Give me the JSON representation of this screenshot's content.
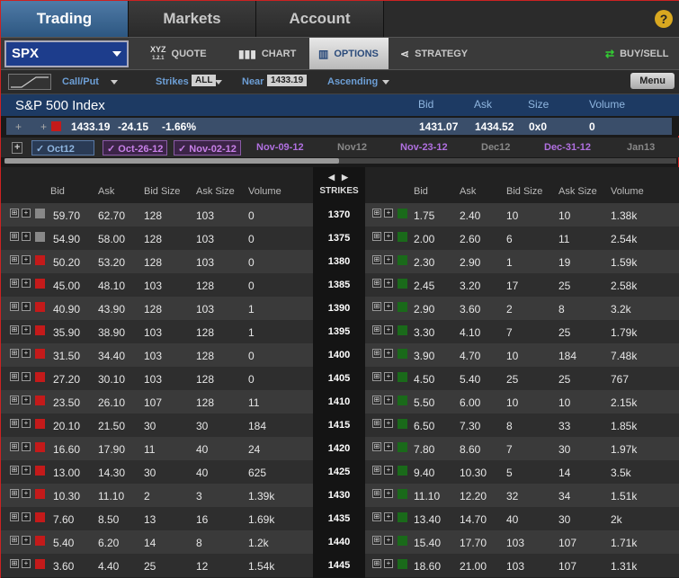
{
  "nav": {
    "tabs": [
      "Trading",
      "Markets",
      "Account"
    ],
    "help": "?"
  },
  "toolbar": {
    "symbol": "SPX",
    "quote_icon_text": "XYZ",
    "quote_icon_sub": "1.2.1",
    "quote": "QUOTE",
    "chart": "CHART",
    "options": "OPTIONS",
    "strategy": "STRATEGY",
    "buysell": "BUY/SELL"
  },
  "optbar": {
    "callput": "Call/Put",
    "strikes_label": "Strikes",
    "strikes_value": "ALL",
    "near_label": "Near",
    "near_value": "1433.19",
    "order": "Ascending",
    "menu": "Menu"
  },
  "index": {
    "name": "S&P 500 Index",
    "headers": {
      "bid": "Bid",
      "ask": "Ask",
      "size": "Size",
      "volume": "Volume"
    },
    "last": "1433.19",
    "change": "-24.15",
    "pct": "-1.66%",
    "bid": "1431.07",
    "ask": "1434.52",
    "size": "0x0",
    "volume": "0"
  },
  "expirations": [
    "Oct12",
    "Oct-26-12",
    "Nov-02-12",
    "Nov-09-12",
    "Nov12",
    "Nov-23-12",
    "Dec12",
    "Dec-31-12",
    "Jan13"
  ],
  "grid": {
    "strikes_title": "STRIKES",
    "call_headers": [
      "Bid",
      "Ask",
      "Bid Size",
      "Ask Size",
      "Volume"
    ],
    "put_headers": [
      "Bid",
      "Ask",
      "Bid Size",
      "Ask Size",
      "Volume"
    ],
    "rows": [
      {
        "strike": "1370",
        "call": [
          "59.70",
          "62.70",
          "128",
          "103",
          "0"
        ],
        "put": [
          "1.75",
          "2.40",
          "10",
          "10",
          "1.38k"
        ],
        "call_color": "#888888"
      },
      {
        "strike": "1375",
        "call": [
          "54.90",
          "58.00",
          "128",
          "103",
          "0"
        ],
        "put": [
          "2.00",
          "2.60",
          "6",
          "11",
          "2.54k"
        ],
        "call_color": "#888888"
      },
      {
        "strike": "1380",
        "call": [
          "50.20",
          "53.20",
          "128",
          "103",
          "0"
        ],
        "put": [
          "2.30",
          "2.90",
          "1",
          "19",
          "1.59k"
        ],
        "call_color": "#c41a1a"
      },
      {
        "strike": "1385",
        "call": [
          "45.00",
          "48.10",
          "103",
          "128",
          "0"
        ],
        "put": [
          "2.45",
          "3.20",
          "17",
          "25",
          "2.58k"
        ],
        "call_color": "#c41a1a"
      },
      {
        "strike": "1390",
        "call": [
          "40.90",
          "43.90",
          "128",
          "103",
          "1"
        ],
        "put": [
          "2.90",
          "3.60",
          "2",
          "8",
          "3.2k"
        ],
        "call_color": "#c41a1a"
      },
      {
        "strike": "1395",
        "call": [
          "35.90",
          "38.90",
          "103",
          "128",
          "1"
        ],
        "put": [
          "3.30",
          "4.10",
          "7",
          "25",
          "1.79k"
        ],
        "call_color": "#c41a1a"
      },
      {
        "strike": "1400",
        "call": [
          "31.50",
          "34.40",
          "103",
          "128",
          "0"
        ],
        "put": [
          "3.90",
          "4.70",
          "10",
          "184",
          "7.48k"
        ],
        "call_color": "#c41a1a"
      },
      {
        "strike": "1405",
        "call": [
          "27.20",
          "30.10",
          "103",
          "128",
          "0"
        ],
        "put": [
          "4.50",
          "5.40",
          "25",
          "25",
          "767"
        ],
        "call_color": "#c41a1a"
      },
      {
        "strike": "1410",
        "call": [
          "23.50",
          "26.10",
          "107",
          "128",
          "11"
        ],
        "put": [
          "5.50",
          "6.00",
          "10",
          "10",
          "2.15k"
        ],
        "call_color": "#c41a1a"
      },
      {
        "strike": "1415",
        "call": [
          "20.10",
          "21.50",
          "30",
          "30",
          "184"
        ],
        "put": [
          "6.50",
          "7.30",
          "8",
          "33",
          "1.85k"
        ],
        "call_color": "#c41a1a"
      },
      {
        "strike": "1420",
        "call": [
          "16.60",
          "17.90",
          "11",
          "40",
          "24"
        ],
        "put": [
          "7.80",
          "8.60",
          "7",
          "30",
          "1.97k"
        ],
        "call_color": "#c41a1a"
      },
      {
        "strike": "1425",
        "call": [
          "13.00",
          "14.30",
          "30",
          "40",
          "625"
        ],
        "put": [
          "9.40",
          "10.30",
          "5",
          "14",
          "3.5k"
        ],
        "call_color": "#c41a1a"
      },
      {
        "strike": "1430",
        "call": [
          "10.30",
          "11.10",
          "2",
          "3",
          "1.39k"
        ],
        "put": [
          "11.10",
          "12.20",
          "32",
          "34",
          "1.51k"
        ],
        "call_color": "#c41a1a"
      },
      {
        "strike": "1435",
        "call": [
          "7.60",
          "8.50",
          "13",
          "16",
          "1.69k"
        ],
        "put": [
          "13.40",
          "14.70",
          "40",
          "30",
          "2k"
        ],
        "call_color": "#c41a1a"
      },
      {
        "strike": "1440",
        "call": [
          "5.40",
          "6.20",
          "14",
          "8",
          "1.2k"
        ],
        "put": [
          "15.40",
          "17.70",
          "103",
          "107",
          "1.71k"
        ],
        "call_color": "#c41a1a"
      },
      {
        "strike": "1445",
        "call": [
          "3.60",
          "4.40",
          "25",
          "12",
          "1.54k"
        ],
        "put": [
          "18.60",
          "21.00",
          "103",
          "107",
          "1.31k"
        ],
        "call_color": "#c41a1a"
      }
    ],
    "put_color": "#1a6a1a"
  }
}
